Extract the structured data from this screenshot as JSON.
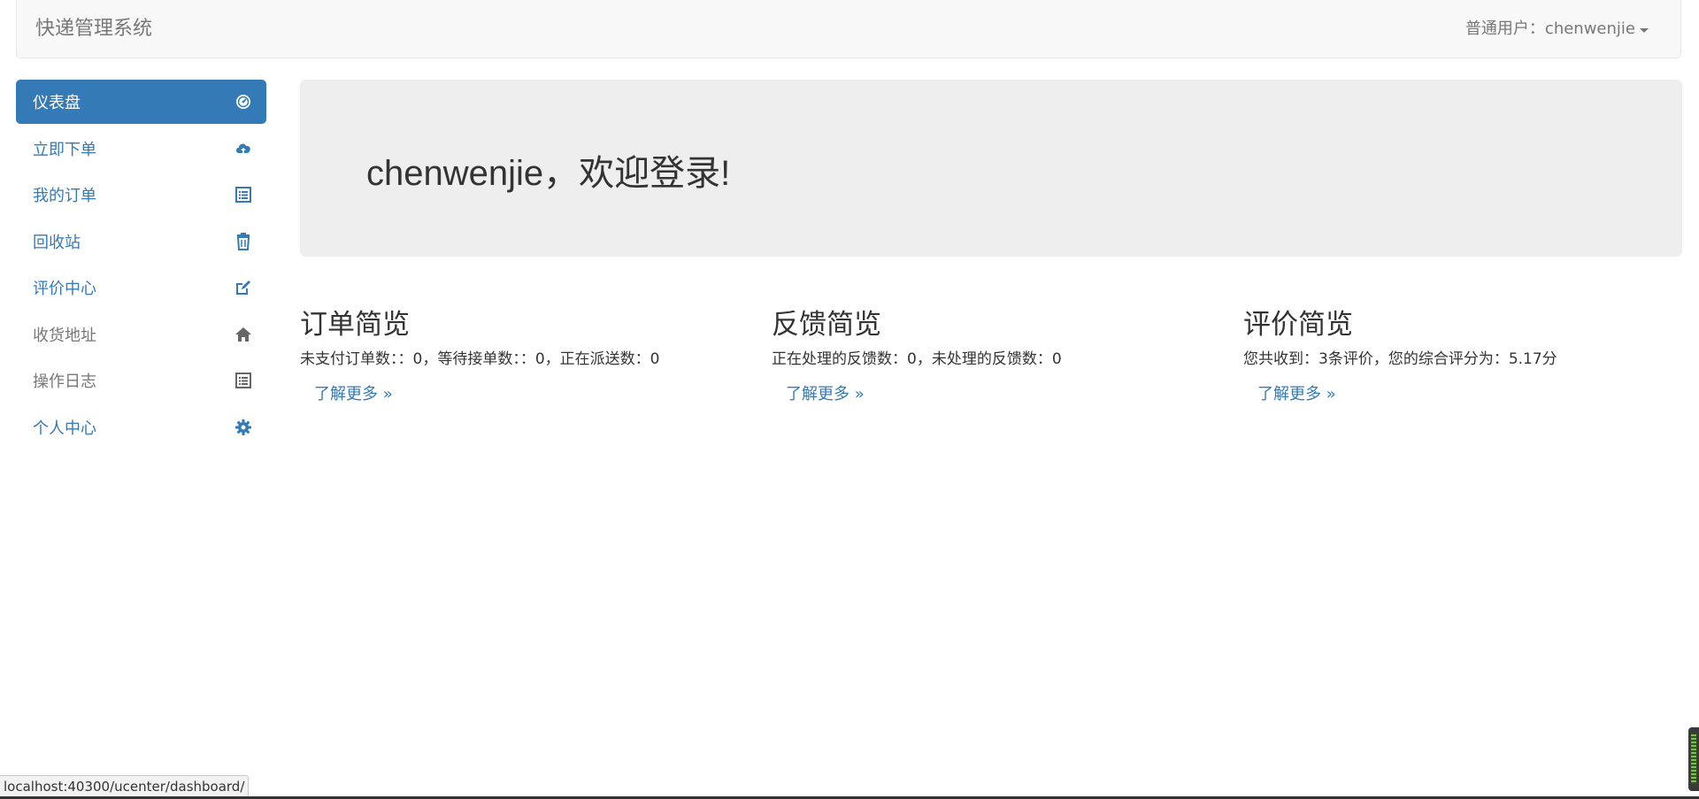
{
  "navbar": {
    "brand": "快递管理系统",
    "user_label": "普通用户：chenwenjie"
  },
  "sidebar": {
    "items": [
      {
        "label": "仪表盘",
        "icon": "dashboard-icon",
        "active": true
      },
      {
        "label": "立即下单",
        "icon": "cloud-upload-icon"
      },
      {
        "label": "我的订单",
        "icon": "list-icon"
      },
      {
        "label": "回收站",
        "icon": "trash-icon"
      },
      {
        "label": "评价中心",
        "icon": "edit-icon"
      },
      {
        "label": "收货地址",
        "icon": "home-icon"
      },
      {
        "label": "操作日志",
        "icon": "list-icon"
      },
      {
        "label": "个人中心",
        "icon": "gear-icon"
      }
    ]
  },
  "jumbotron": {
    "greeting": "chenwenjie，欢迎登录!"
  },
  "panels": [
    {
      "title": "订单简览",
      "text": "未支付订单数：：0，等待接单数：：0，正在派送数：0",
      "link": "了解更多 »"
    },
    {
      "title": "反馈简览",
      "text": "正在处理的反馈数：0，未处理的反馈数：0",
      "link": "了解更多 »"
    },
    {
      "title": "评价简览",
      "text": "您共收到：3条评价，您的综合评分为：5.17分",
      "link": "了解更多 »"
    }
  ],
  "statusbar": {
    "url": "localhost:40300/ucenter/dashboard/"
  },
  "colors": {
    "primary": "#337ab7",
    "muted": "#777777",
    "jumbotron_bg": "#eeeeee",
    "navbar_bg": "#f8f8f8"
  }
}
